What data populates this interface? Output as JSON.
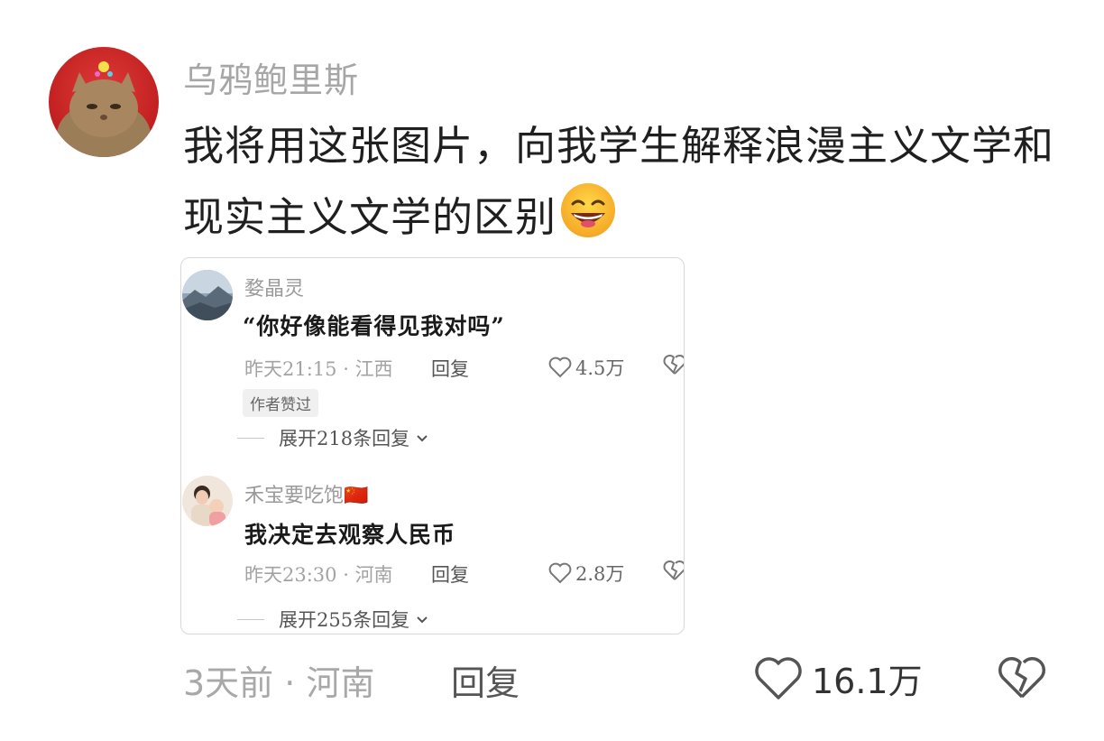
{
  "comment": {
    "username": "乌鸦鲍里斯",
    "text": "我将用这张图片，向我学生解释浪漫主义文学和现实主义文学的区别",
    "emoji": "grinning-sweat-emoji",
    "time": "3天前",
    "location": "河南",
    "reply_label": "回复",
    "likes": "16.1万"
  },
  "quoted_image": {
    "comments": [
      {
        "username": "婺晶灵",
        "text": "“你好像能看得见我对吗”",
        "time": "昨天21:15",
        "location": "江西",
        "reply_label": "回复",
        "likes": "4.5万",
        "badge": "作者赞过",
        "expand_label": "展开218条回复"
      },
      {
        "username": "禾宝要吃饱🇨🇳",
        "text": "我决定去观察人民币",
        "time": "昨天23:30",
        "location": "河南",
        "reply_label": "回复",
        "likes": "2.8万",
        "expand_label": "展开255条回复"
      }
    ]
  },
  "colors": {
    "username": "#a6a6a6",
    "text": "#1f1f1f",
    "meta": "#a8a8a8"
  }
}
